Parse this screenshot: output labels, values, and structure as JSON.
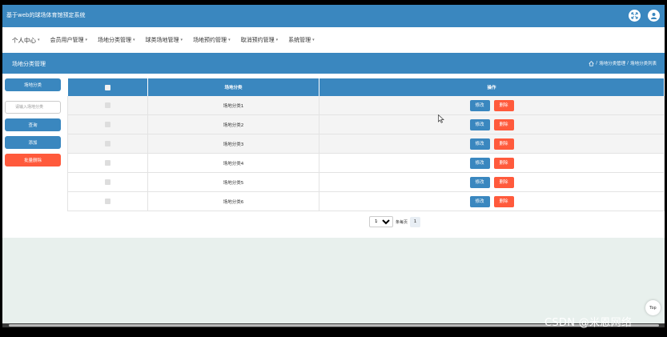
{
  "app": {
    "title": "基于web的球场体育馆预定系统"
  },
  "menu": [
    {
      "label": "个人中心",
      "has_caret": true
    },
    {
      "label": "会员用户管理",
      "has_caret": true
    },
    {
      "label": "场地分类管理",
      "has_caret": true
    },
    {
      "label": "球类场地管理",
      "has_caret": true
    },
    {
      "label": "场地预约管理",
      "has_caret": true
    },
    {
      "label": "取消预约管理",
      "has_caret": true
    },
    {
      "label": "系统管理",
      "has_caret": true
    }
  ],
  "page": {
    "title": "场地分类管理",
    "breadcrumb": [
      "场地分类管理",
      "场地分类列表"
    ],
    "breadcrumb_sep": "/"
  },
  "left": {
    "filter_label": "场地分类",
    "search_placeholder": "请输入场地分类",
    "query_label": "查询",
    "add_label": "添加",
    "batch_delete_label": "批量删除"
  },
  "table": {
    "columns": [
      "",
      "场地分类",
      "操作"
    ],
    "rows": [
      {
        "category": "场地分类1"
      },
      {
        "category": "场地分类2"
      },
      {
        "category": "场地分类3"
      },
      {
        "category": "场地分类4"
      },
      {
        "category": "场地分类5"
      },
      {
        "category": "场地分类6"
      }
    ],
    "edit_label": "修改",
    "delete_label": "删除"
  },
  "pagination": {
    "page_size": "10",
    "page_size_options": [
      "10"
    ],
    "total_label": "条每页",
    "current_page": "1"
  },
  "top_button": "Top",
  "watermark": "CSDN @米恩网络",
  "colors": {
    "primary": "#3a87bf",
    "danger": "#ff5a3c",
    "footer_bg": "#e8f0ed"
  }
}
